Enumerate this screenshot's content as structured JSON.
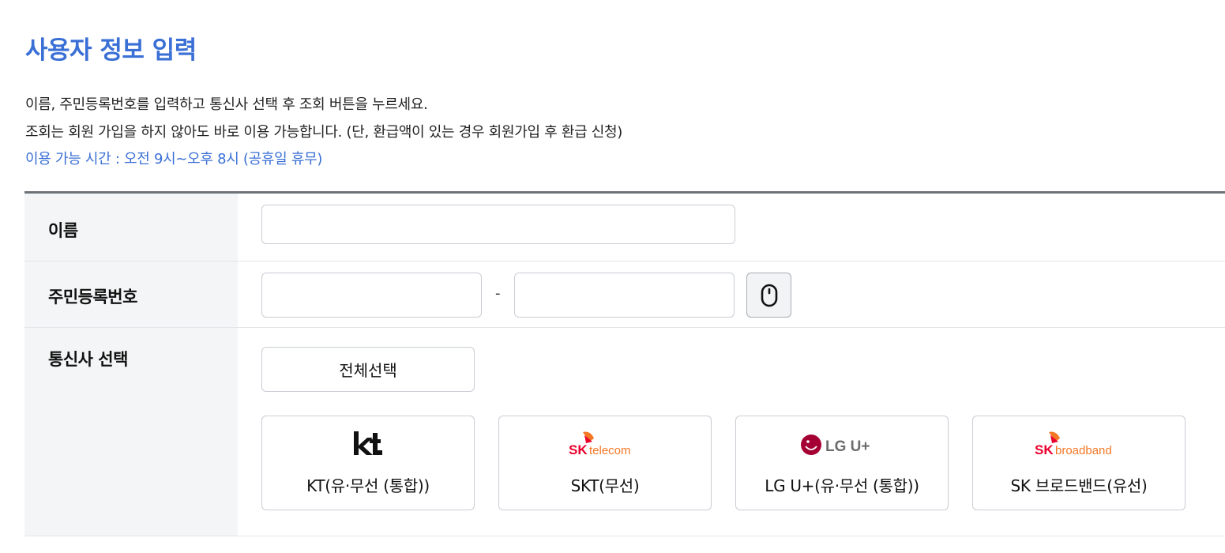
{
  "header": {
    "title": "사용자 정보 입력",
    "desc_line1": "이름, 주민등록번호를 입력하고 통신사 선택 후 조회 버튼을 누르세요.",
    "desc_line2": "조회는 회원 가입을 하지 않아도 바로 이용 가능합니다. (단, 환급액이 있는 경우 회원가입 후 환급 신청)",
    "hours": "이용 가능 시간 : 오전 9시~오후 8시 (공휴일 휴무)"
  },
  "form": {
    "name_label": "이름",
    "name_value": "",
    "rrn_label": "주민등록번호",
    "rrn_front_value": "",
    "rrn_separator": "-",
    "rrn_back_value": "",
    "mouse_input_icon": "mouse-icon",
    "carrier_label": "통신사 선택",
    "select_all_label": "전체선택",
    "carriers": [
      {
        "label": "KT(유·무선 (통합))",
        "logo_text": "kt",
        "logo_color": "#111111",
        "icon": "kt-logo-icon"
      },
      {
        "label": "SKT(무선)",
        "logo_brand": "SK",
        "logo_text": "telecom",
        "logo_color": "#ea002c",
        "accent_color": "#f47725",
        "icon": "sk-telecom-logo-icon"
      },
      {
        "label": "LG U+(유·무선 (통합))",
        "logo_text": "LG U+",
        "logo_color": "#a50034",
        "text_color": "#6b6b6b",
        "icon": "lg-uplus-logo-icon"
      },
      {
        "label": "SK 브로드밴드(유선)",
        "logo_brand": "SK",
        "logo_text": "broadband",
        "logo_color": "#ea002c",
        "accent_color": "#f47725",
        "icon": "sk-broadband-logo-icon"
      }
    ]
  },
  "colors": {
    "accent": "#3a6fd6",
    "table_header_bg": "#f4f5f6",
    "table_top_border": "#6e7378"
  }
}
